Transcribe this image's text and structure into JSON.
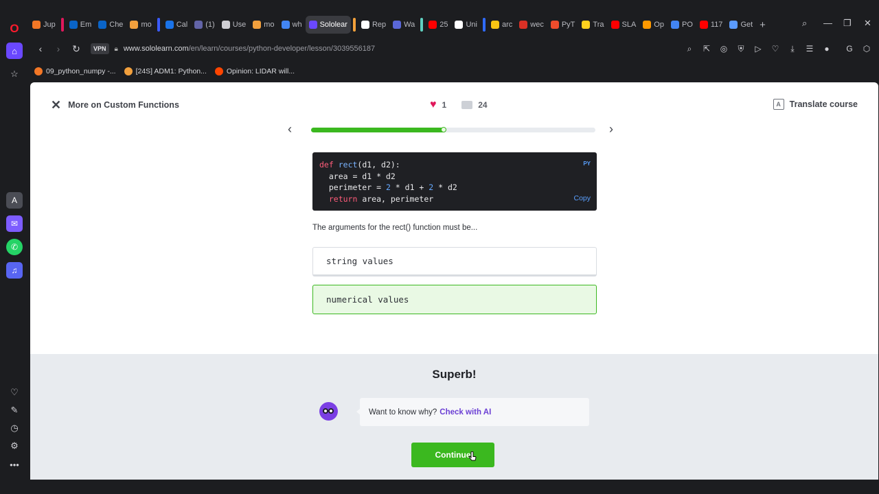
{
  "browser": {
    "tabs": [
      {
        "label": "Jup",
        "color": "#f37726"
      },
      {
        "label": "Em",
        "color": "#0a64c8"
      },
      {
        "label": "Che",
        "color": "#0a64c8"
      },
      {
        "label": "mo",
        "color": "#f2a03d"
      },
      {
        "label": "Cal",
        "color": "#1a73e8"
      },
      {
        "label": "(1)",
        "color": "#6264a7"
      },
      {
        "label": "Use",
        "color": "#cfcfd4"
      },
      {
        "label": "mo",
        "color": "#f2a03d"
      },
      {
        "label": "wh",
        "color": "#4285f4"
      },
      {
        "label": "Sololear",
        "color": "#6a48ff",
        "active": true
      },
      {
        "label": "Rep",
        "color": "#ffffff"
      },
      {
        "label": "Wa",
        "color": "#5a67d8"
      },
      {
        "label": "25",
        "color": "#ff0000"
      },
      {
        "label": "Uni",
        "color": "#ffffff"
      },
      {
        "label": "arc",
        "color": "#f9c513"
      },
      {
        "label": "wec",
        "color": "#d93025"
      },
      {
        "label": "PyT",
        "color": "#ee4c2c"
      },
      {
        "label": "Tra",
        "color": "#ffd21e"
      },
      {
        "label": "SLA",
        "color": "#ff0000"
      },
      {
        "label": "Op",
        "color": "#ff9900"
      },
      {
        "label": "PO",
        "color": "#4285f4"
      },
      {
        "label": "117",
        "color": "#ff0000"
      },
      {
        "label": "Get",
        "color": "#5a9bff"
      }
    ],
    "vpn_label": "VPN",
    "url_host": "www.sololearn.com",
    "url_path": "/en/learn/courses/python-developer/lesson/3039556187",
    "bookmarks": [
      {
        "label": "09_python_numpy -...",
        "color": "#f37726"
      },
      {
        "label": "[24S] ADM1: Python...",
        "color": "#f2a03d"
      },
      {
        "label": "Opinion: LIDAR will...",
        "color": "#ff4500"
      }
    ]
  },
  "lesson": {
    "close_label": "More on Custom Functions",
    "likes": "1",
    "comments": "24",
    "translate_label": "Translate course",
    "progress": 0.47,
    "code": {
      "lang": "PY",
      "copy_label": "Copy",
      "line1": {
        "kw": "def",
        "fn": "rect",
        "rest": "(d1, d2):"
      },
      "line2": "  area = d1 * d2",
      "line3": {
        "a": "  perimeter = ",
        "n1": "2",
        "b": " * d1 + ",
        "n2": "2",
        "c": " * d2"
      },
      "line4": {
        "kw": "  return",
        "rest": " area, perimeter"
      }
    },
    "question": "The arguments for the rect() function must be...",
    "options": [
      "string values",
      "numerical values"
    ]
  },
  "feedback": {
    "title": "Superb!",
    "prompt": "Want to know why?",
    "ai_link": "Check with AI",
    "continue_label": "Continue"
  },
  "colors": {
    "accent_green": "#3bb81f",
    "accent_purple": "#6b3fd4",
    "heart": "#e0185b"
  }
}
